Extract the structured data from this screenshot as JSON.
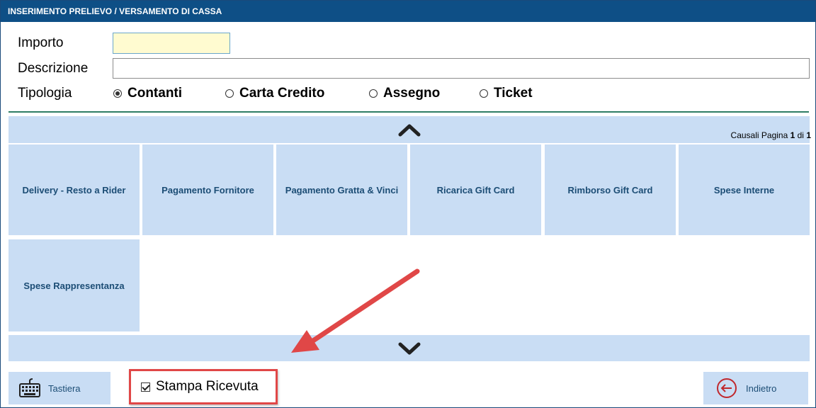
{
  "window": {
    "title": "INSERIMENTO PRELIEVO / VERSAMENTO DI CASSA"
  },
  "form": {
    "importo_label": "Importo",
    "importo_value": "",
    "descrizione_label": "Descrizione",
    "descrizione_value": "",
    "tipologia_label": "Tipologia",
    "tipologia_options": [
      {
        "label": "Contanti",
        "selected": true
      },
      {
        "label": "Carta Credito",
        "selected": false
      },
      {
        "label": "Assegno",
        "selected": false
      },
      {
        "label": "Ticket",
        "selected": false
      }
    ]
  },
  "pagination": {
    "prefix": "Causali Pagina",
    "current": "1",
    "separator": "di",
    "total": "1"
  },
  "causali": [
    "Delivery - Resto a Rider",
    "Pagamento Fornitore",
    "Pagamento Gratta & Vinci",
    "Ricarica Gift Card",
    "Rimborso Gift Card",
    "Spese Interne",
    "Spese Rappresentanza"
  ],
  "footer": {
    "keyboard_label": "Tastiera",
    "print_receipt_label": "Stampa Ricevuta",
    "print_receipt_checked": true,
    "back_label": "Indietro"
  },
  "icons": {
    "scroll_up": "chevron-up-icon",
    "scroll_down": "chevron-down-icon",
    "keyboard": "keyboard-icon",
    "back": "back-arrow-icon"
  },
  "colors": {
    "titlebar": "#0e4f86",
    "tile_bg": "#c9ddf4",
    "tile_text": "#1c4d75",
    "highlight": "#e04747",
    "importo_bg": "#fffbd0"
  }
}
